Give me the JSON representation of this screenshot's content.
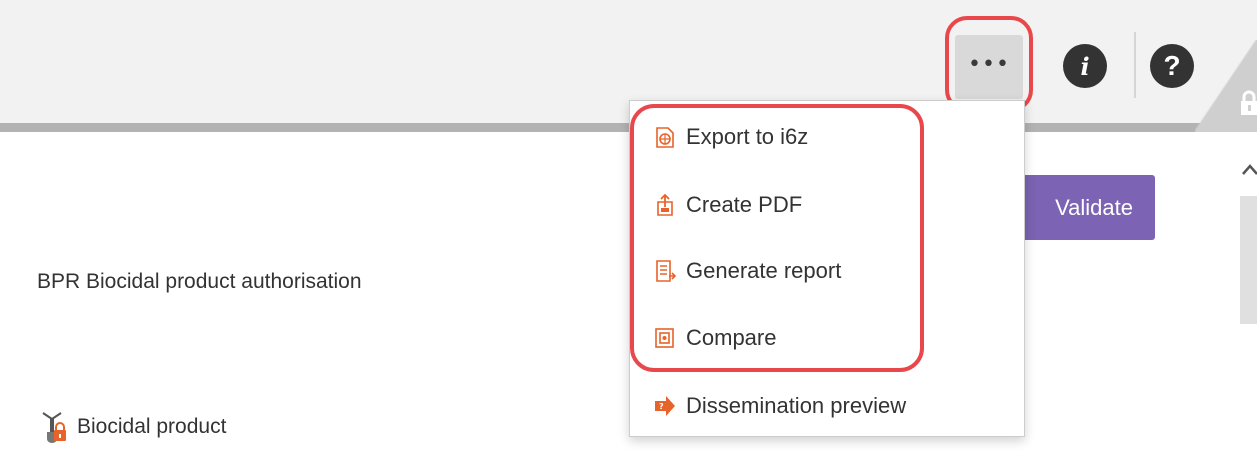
{
  "toolbar": {
    "more_label": "•••",
    "info_label": "i",
    "help_label": "?"
  },
  "main": {
    "subtitle": "BPR Biocidal product authorisation",
    "validate_label": "Validate",
    "tree_item_label": "Biocidal product"
  },
  "menu": {
    "items": [
      {
        "label": "Export to i6z",
        "icon": "export-i6z-icon"
      },
      {
        "label": "Create PDF",
        "icon": "pdf-icon"
      },
      {
        "label": "Generate report",
        "icon": "report-icon"
      },
      {
        "label": "Compare",
        "icon": "compare-icon"
      },
      {
        "label": "Dissemination preview",
        "icon": "dissemination-arrow-icon"
      }
    ]
  },
  "colors": {
    "accent_purple": "#7c63b3",
    "icon_orange": "#e8632a",
    "highlight_red": "#e8474b"
  }
}
